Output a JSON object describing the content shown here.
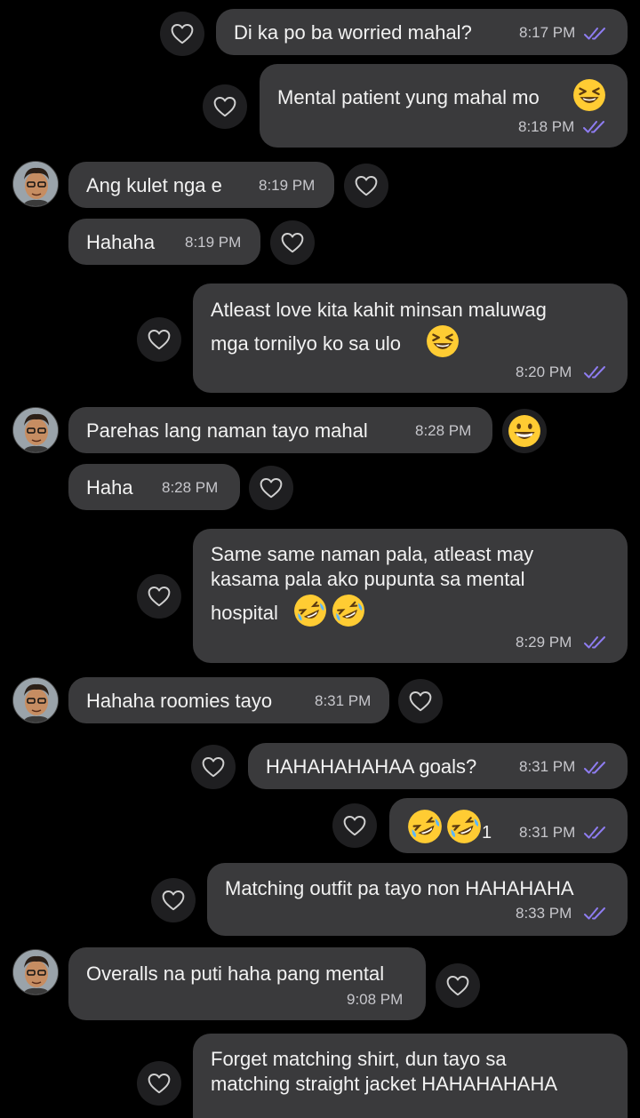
{
  "messages": [
    {
      "side": "out",
      "text": "Di ka po ba worried mahal?",
      "time": "8:17 PM"
    },
    {
      "side": "out",
      "text": "Mental patient yung mahal mo",
      "emoji": "laughing",
      "time": "8:18 PM"
    },
    {
      "side": "in",
      "text": "Ang kulet nga e",
      "time": "8:19 PM"
    },
    {
      "side": "in",
      "text": "Hahaha",
      "time": "8:19 PM"
    },
    {
      "side": "out",
      "text_line1": "Atleast love kita kahit minsan maluwag",
      "text_line2": "mga tornilyo ko sa ulo",
      "emoji": "laughing",
      "time": "8:20 PM"
    },
    {
      "side": "in",
      "text": "Parehas lang naman tayo mahal",
      "time": "8:28 PM",
      "reaction": "grinning"
    },
    {
      "side": "in",
      "text": "Haha",
      "time": "8:28 PM"
    },
    {
      "side": "out",
      "text_line1": "Same same naman pala, atleast may",
      "text_line2": "kasama pala ako pupunta sa mental",
      "text_line3": "hospital",
      "emoji": "rofl",
      "time": "8:29 PM"
    },
    {
      "side": "in",
      "text": "Hahaha roomies tayo",
      "time": "8:31 PM"
    },
    {
      "side": "out",
      "text": "HAHAHAHAHAA goals?",
      "time": "8:31 PM"
    },
    {
      "side": "out",
      "text": "1",
      "emoji": "rofl",
      "time": "8:31 PM"
    },
    {
      "side": "out",
      "text": "Matching outfit pa tayo non HAHAHAHA",
      "time": "8:33 PM"
    },
    {
      "side": "in",
      "text": "Overalls na puti haha pang mental",
      "time": "9:08 PM"
    },
    {
      "side": "out",
      "text_line1": "Forget matching shirt, dun tayo sa",
      "text_line2": "matching straight jacket HAHAHAHAHA"
    }
  ],
  "icons": {
    "like": "heart-outline-icon",
    "read": "double-check-icon",
    "avatar": "contact-avatar"
  },
  "colors": {
    "bubble": "#3a3a3c",
    "read_tick": "#8e7cf0",
    "background": "#000000"
  }
}
